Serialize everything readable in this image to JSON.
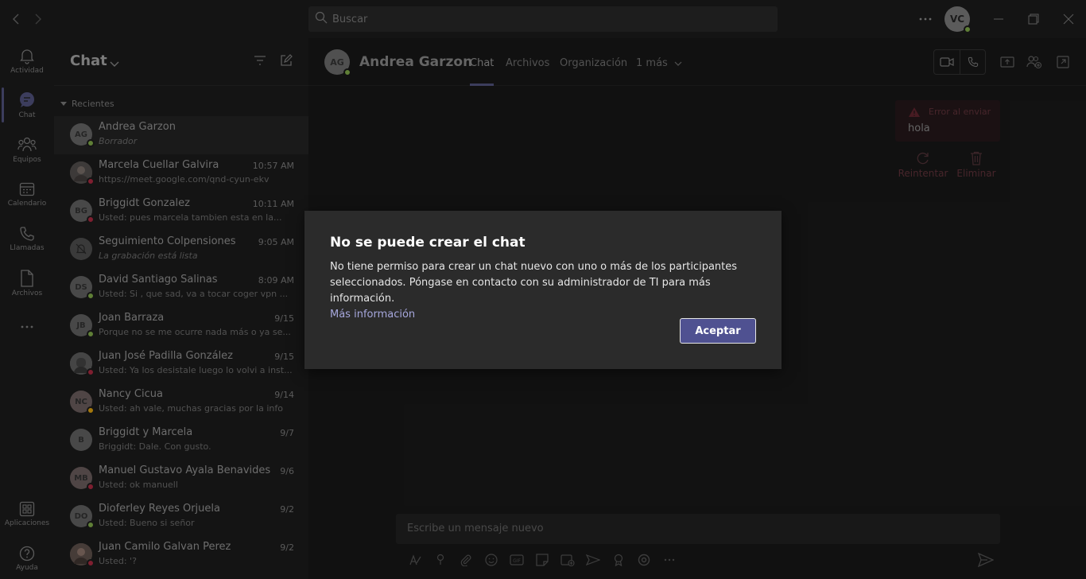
{
  "titlebar": {
    "search_placeholder": "Buscar",
    "user_initials": "VC",
    "more_icon": "more-icon"
  },
  "rail": {
    "items": [
      {
        "label": "Actividad",
        "icon": "bell-icon"
      },
      {
        "label": "Chat",
        "icon": "chat-icon"
      },
      {
        "label": "Equipos",
        "icon": "teams-icon"
      },
      {
        "label": "Calendario",
        "icon": "calendar-icon"
      },
      {
        "label": "Llamadas",
        "icon": "phone-icon"
      },
      {
        "label": "Archivos",
        "icon": "file-icon"
      }
    ],
    "bottom": [
      {
        "label": "Aplicaciones",
        "icon": "apps-icon"
      },
      {
        "label": "Ayuda",
        "icon": "help-icon"
      }
    ]
  },
  "list": {
    "title": "Chat",
    "section": "Recientes",
    "rows": [
      {
        "initials": "AG",
        "name": "Andrea Garzon",
        "time": "",
        "preview": "Borrador",
        "italic": true,
        "status": "#92c353"
      },
      {
        "initials": "",
        "name": "Marcela Cuellar Galvira",
        "time": "10:57 AM",
        "preview": "https://meet.google.com/qnd-cyun-ekv",
        "italic": false,
        "status": "#c4314b"
      },
      {
        "initials": "BG",
        "name": "Briggidt Gonzalez",
        "time": "10:11 AM",
        "preview": "Usted: pues marcela tambien esta en la...",
        "italic": false,
        "status": "#c4314b"
      },
      {
        "initials": "",
        "name": "Seguimiento Colpensiones",
        "time": "9:05 AM",
        "preview": "La grabación está lista",
        "italic": true,
        "status": ""
      },
      {
        "initials": "DS",
        "name": "David Santiago Salinas",
        "time": "8:09 AM",
        "preview": "Usted: Si , que sad, va a tocar coger vpn ...",
        "italic": false,
        "status": "#92c353"
      },
      {
        "initials": "JB",
        "name": "Joan Barraza",
        "time": "9/15",
        "preview": "Porque no se me ocurre nada más o ya se...",
        "italic": false,
        "status": "#92c353"
      },
      {
        "initials": "",
        "name": "Juan José Padilla González",
        "time": "9/15",
        "preview": "Usted: Ya los desistale luego lo volvi a inst...",
        "italic": false,
        "status": "#c4314b"
      },
      {
        "initials": "NC",
        "name": "Nancy Cicua",
        "time": "9/14",
        "preview": "Usted: ah vale, muchas gracias por la info",
        "italic": false,
        "status": "#fdb913"
      },
      {
        "initials": "B",
        "name": "Briggidt y Marcela",
        "time": "9/7",
        "preview": "Briggidt: Dale. Con gusto.",
        "italic": false,
        "status": ""
      },
      {
        "initials": "MB",
        "name": "Manuel Gustavo Ayala Benavides",
        "time": "9/6",
        "preview": "Usted: ok manuell",
        "italic": false,
        "status": "#c4314b"
      },
      {
        "initials": "DO",
        "name": "Dioferley Reyes Orjuela",
        "time": "9/2",
        "preview": "Usted: Bueno si señor",
        "italic": false,
        "status": "#92c353"
      },
      {
        "initials": "",
        "name": "Juan Camilo Galvan Perez",
        "time": "9/2",
        "preview": "Usted: '?",
        "italic": false,
        "status": "#c4314b"
      }
    ]
  },
  "main": {
    "contact_initials": "AG",
    "contact_name": "Andrea Garzon",
    "tabs": [
      "Chat",
      "Archivos",
      "Organización",
      "1 más"
    ],
    "error_label": "Error al enviar",
    "error_message": "hola",
    "retry_label": "Reintentar",
    "delete_label": "Eliminar",
    "composer_placeholder": "Escribe un mensaje nuevo"
  },
  "dialog": {
    "title": "No se puede crear el chat",
    "body": "No tiene permiso para crear un chat nuevo con uno o más de los participantes seleccionados. Póngase en contacto con su administrador de TI para más información.",
    "link": "Más información",
    "button": "Aceptar"
  },
  "colors": {
    "accent": "#5d5e8f",
    "button": "#4f5191",
    "error": "#c4314b",
    "available": "#92c353"
  }
}
